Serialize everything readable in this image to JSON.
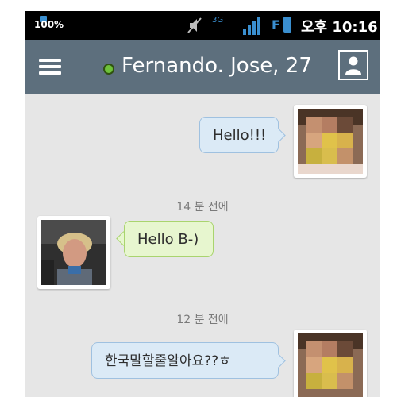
{
  "status_bar": {
    "battery_percent": "100%",
    "network": "3G",
    "carrier_label": "F",
    "time": "오후 10:16"
  },
  "header": {
    "contact_name": "Fernando. Jose, 27",
    "online": true
  },
  "messages": [
    {
      "direction": "outgoing",
      "text": "Hello!!!"
    },
    {
      "direction": "incoming",
      "text": "Hello B-)"
    },
    {
      "direction": "outgoing",
      "text": "한국말할줄알아요??ㅎ"
    }
  ],
  "timestamps": [
    "14 분 전에",
    "12 분 전에"
  ],
  "colors": {
    "appbar": "#5d6f7d",
    "outgoing_bubble": "#dbeaf6",
    "incoming_bubble": "#e7f6cf",
    "online": "#6ec23a"
  }
}
